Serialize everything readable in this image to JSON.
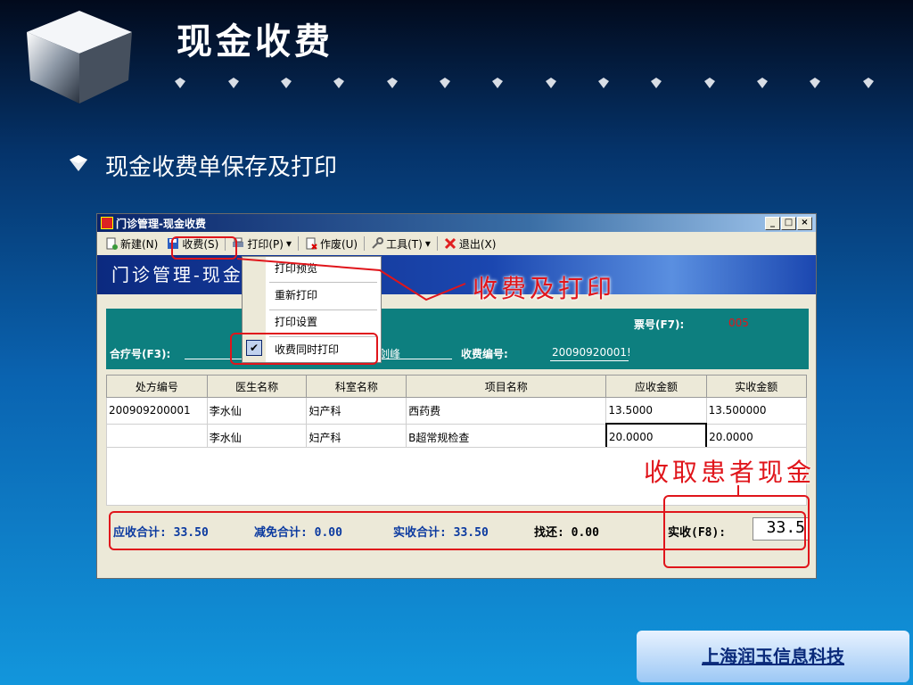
{
  "slide": {
    "title": "现金收费",
    "bullet": "现金收费单保存及打印"
  },
  "window": {
    "title": "门诊管理-现金收费",
    "controls": {
      "minimize": "_",
      "maximize": "□",
      "close": "×"
    },
    "toolbar": {
      "new": "新建(N)",
      "charge": "收费(S)",
      "print": "打印(P)",
      "void": "作废(U)",
      "tools": "工具(T)",
      "exit": "退出(X)"
    },
    "banner": "门诊管理-现金",
    "print_menu": {
      "preview": "打印预览",
      "reprint": "重新打印",
      "settings": "打印设置",
      "print_on_charge": "收费同时打印"
    },
    "form": {
      "invoice_label": "票号(F7):",
      "invoice_value": "005",
      "card_label": "合疗号(F3):",
      "doctor_partial": "剑峰",
      "charge_no_label": "收费编号:",
      "charge_no_value": "20090920001!"
    },
    "table": {
      "headers": [
        "处方编号",
        "医生名称",
        "科室名称",
        "项目名称",
        "应收金额",
        "实收金额"
      ],
      "rows": [
        [
          "200909200001",
          "李水仙",
          "妇产科",
          "西药费",
          "13.5000",
          "13.500000"
        ],
        [
          "",
          "李水仙",
          "妇产科",
          "B超常规检查",
          "20.0000",
          "20.0000"
        ]
      ]
    },
    "totals": {
      "receivable": "应收合计: 33.50",
      "discount": "减免合计: 0.00",
      "actual": "实收合计: 33.50",
      "change": "找还: 0.00",
      "paid_label": "实收(F8):",
      "paid_value": "33.5"
    }
  },
  "callouts": {
    "charge_print": "收费及打印",
    "cash": "收取患者现金"
  },
  "company": "上海润玉信息科技",
  "colors": {
    "annotation": "#e0151b",
    "teal": "#0d7f7f"
  }
}
